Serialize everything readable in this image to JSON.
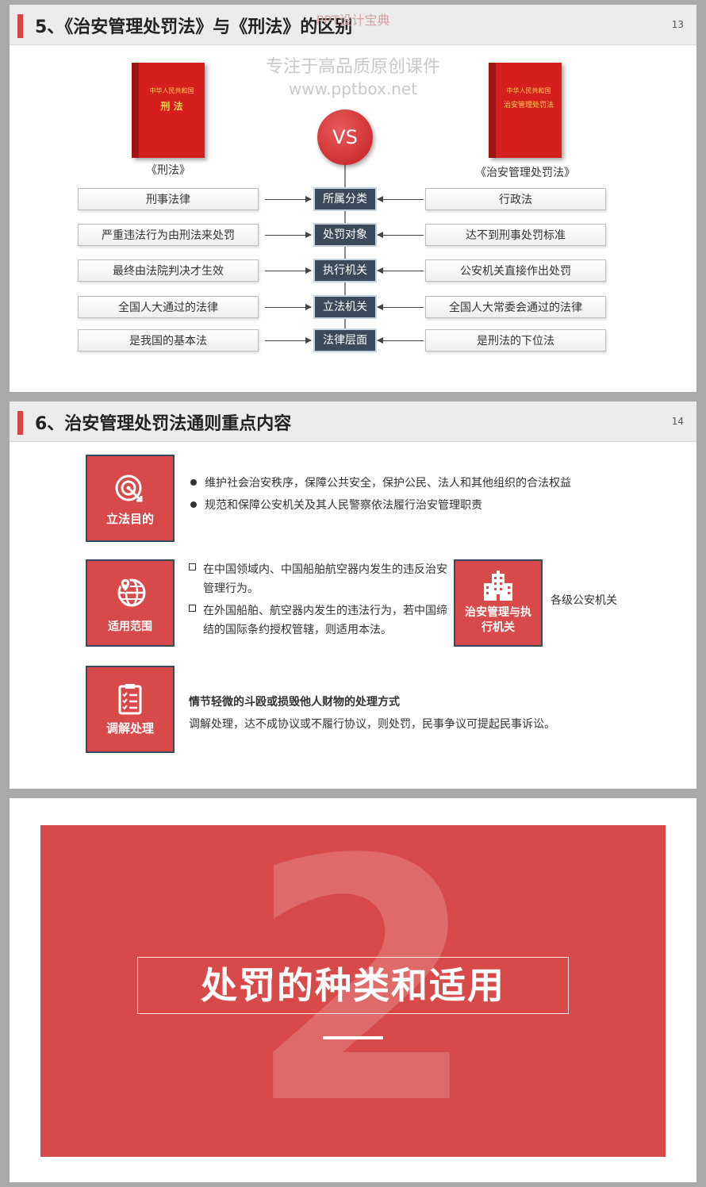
{
  "slide1": {
    "title": "5、《治安管理处罚法》与《刑法》的区别",
    "number": "13",
    "watermark_brand": "PPT设计宝典",
    "watermark_tagline": "专注于高品质原创课件",
    "watermark_url": "www.pptbox.net",
    "vs_label": "VS",
    "left_book": {
      "line1": "中华人民共和国",
      "line2": "刑 法",
      "caption": "《刑法》"
    },
    "right_book": {
      "line1": "中华人民共和国",
      "line2": "治安管理处罚法",
      "caption": "《治安管理处罚法》"
    },
    "rows": [
      {
        "left": "刑事法律",
        "center": "所属分类",
        "right": "行政法"
      },
      {
        "left": "严重违法行为由刑法来处罚",
        "center": "处罚对象",
        "right": "达不到刑事处罚标准"
      },
      {
        "left": "最终由法院判决才生效",
        "center": "执行机关",
        "right": "公安机关直接作出处罚"
      },
      {
        "left": "全国人大通过的法律",
        "center": "立法机关",
        "right": "全国人大常委会通过的法律"
      },
      {
        "left": "是我国的基本法",
        "center": "法律层面",
        "right": "是刑法的下位法"
      }
    ]
  },
  "slide2": {
    "title": "6、治安管理处罚法通则重点内容",
    "number": "14",
    "purpose": {
      "label": "立法目的",
      "icon": "target-icon",
      "bullets": [
        "维护社会治安秩序，保障公共安全，保护公民、法人和其他组织的合法权益",
        "规范和保障公安机关及其人民警察依法履行治安管理职责"
      ]
    },
    "scope": {
      "label": "适用范围",
      "icon": "globe-pin-icon",
      "items": [
        "在中国领域内、中国船舶航空器内发生的违反治安管理行为。",
        "在外国船舶、航空器内发生的违法行为，若中国缔结的国际条约授权管辖，则适用本法。"
      ]
    },
    "agency": {
      "label": "治安管理与执行机关",
      "icon": "building-icon",
      "text": "各级公安机关"
    },
    "mediation": {
      "label": "调解处理",
      "icon": "clipboard-icon",
      "heading": "情节轻微的斗殴或损毁他人财物的处理方式",
      "text": "调解处理，达不成协议或不履行协议，则处罚，民事争议可提起民事诉讼。"
    }
  },
  "slide3": {
    "big_number": "2",
    "title": "处罚的种类和适用"
  },
  "colors": {
    "accent_red": "#d84a4a",
    "navy": "#3a4a5c",
    "book_red": "#d51e1e"
  }
}
